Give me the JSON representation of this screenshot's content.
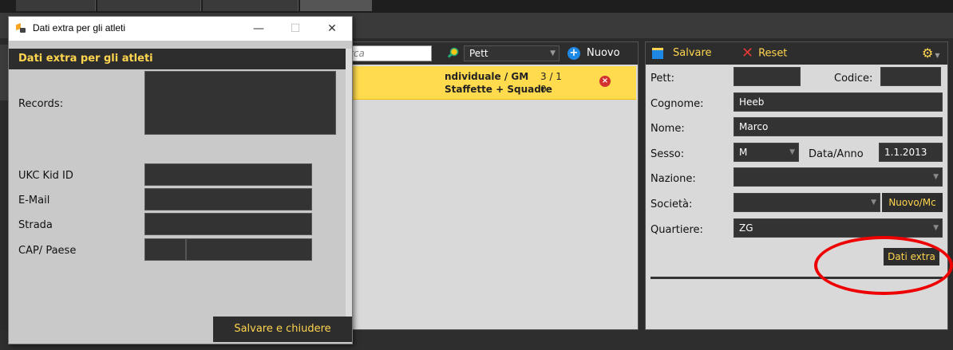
{
  "dialog": {
    "window_title": "Dati extra per gli atleti",
    "header": "Dati extra per gli atleti",
    "minimize": "—",
    "maximize": "☐",
    "close": "✕",
    "fields": {
      "records_label": "Records:",
      "ukc_label": "UKC Kid ID",
      "email_label": "E-Mail",
      "strada_label": "Strada",
      "cap_label": "CAP/ Paese"
    },
    "save_close_label": "Salvare e chiudere"
  },
  "list_panel": {
    "search_placeholder": "rca",
    "sort_label": "Pett",
    "new_label": "Nuovo",
    "row": {
      "line1_label": "ndividuale / GM",
      "line1_count": "3 / 1",
      "line2_label": "Staffette + Squadre",
      "line2_count": "0"
    }
  },
  "detail_panel": {
    "toolbar": {
      "save_label": "Salvare",
      "reset_label": "Reset"
    },
    "pett_label": "Pett:",
    "pett_value": "",
    "codice_label": "Codice:",
    "codice_value": "",
    "cognome_label": "Cognome:",
    "cognome_value": "Heeb",
    "nome_label": "Nome:",
    "nome_value": "Marco",
    "sesso_label": "Sesso:",
    "sesso_value": "M",
    "data_label": "Data/Anno",
    "data_value": "1.1.2013",
    "nazione_label": "Nazione:",
    "nazione_value": "",
    "societa_label": "Società:",
    "societa_value": "",
    "nuovo_mod_label": "Nuovo/Mc",
    "quartiere_label": "Quartiere:",
    "quartiere_value": "ZG",
    "dati_extra_label": "Dati extra"
  },
  "colors": {
    "accent_yellow": "#ffd54f",
    "selected_row": "#ffdb4d",
    "dark_panel": "#2d2d2d",
    "highlight_red": "#e00000"
  }
}
